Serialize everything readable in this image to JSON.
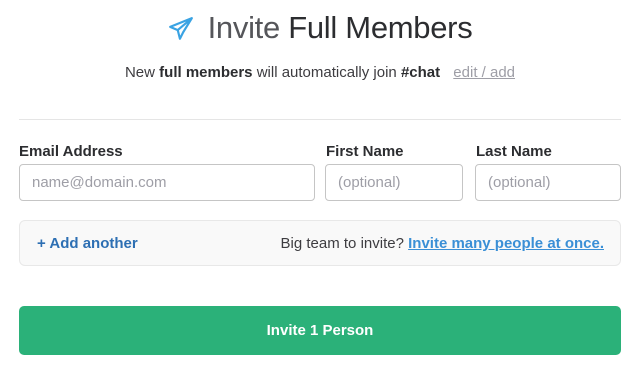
{
  "header": {
    "icon": "paper-plane-icon",
    "title_prefix": "Invite",
    "title_main": "Full Members"
  },
  "subtitle": {
    "text_before": "New",
    "bold_text": "full members",
    "text_middle": "will automatically join",
    "channel": "#chat",
    "edit_link": "edit / add"
  },
  "form": {
    "email_label": "Email Address",
    "email_placeholder": "name@domain.com",
    "email_value": "",
    "first_name_label": "First Name",
    "first_name_placeholder": "(optional)",
    "first_name_value": "",
    "last_name_label": "Last Name",
    "last_name_placeholder": "(optional)",
    "last_name_value": ""
  },
  "add_bar": {
    "add_another_label": "+ Add another",
    "big_team_text": "Big team to invite?",
    "invite_many_link": "Invite many people at once."
  },
  "submit": {
    "label": "Invite 1 Person"
  },
  "colors": {
    "accent_green": "#2bb179",
    "link_blue": "#3a8fd6",
    "plane_blue": "#3aa3e3"
  }
}
